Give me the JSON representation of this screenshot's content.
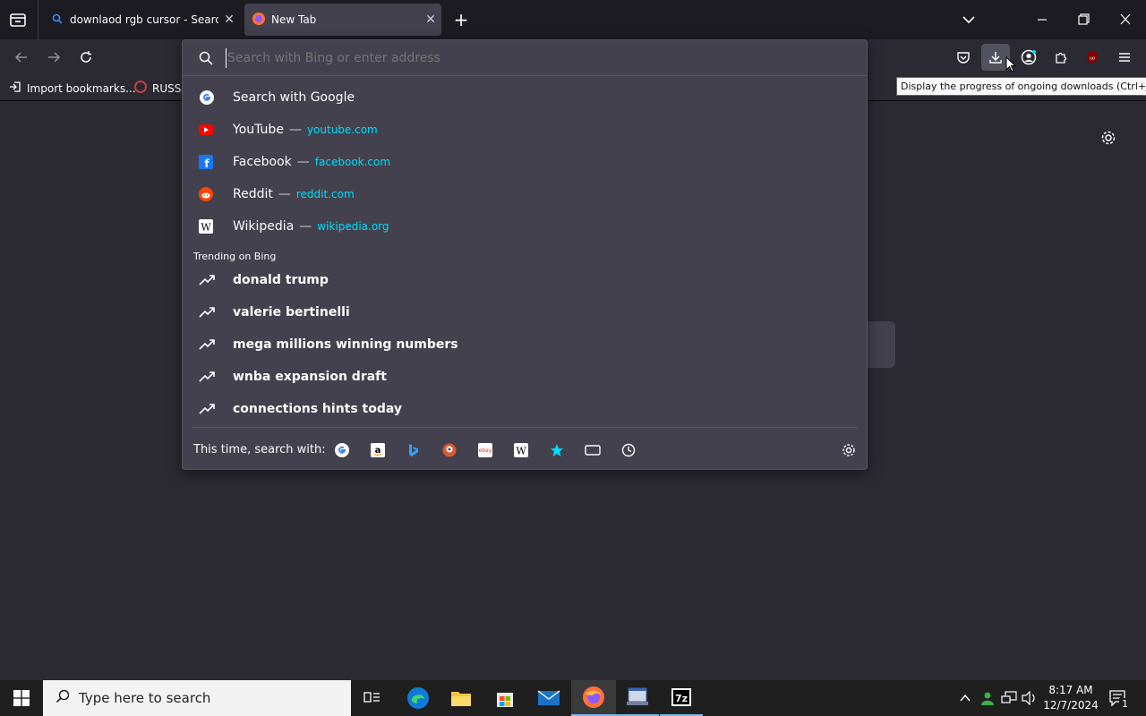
{
  "tabs": [
    {
      "title": "downlaod rgb cursor - Search",
      "active": false
    },
    {
      "title": "New Tab",
      "active": true
    }
  ],
  "address": {
    "placeholder": "Search with Bing or enter address",
    "value": ""
  },
  "bookmarks": [
    {
      "label": "Import bookmarks..."
    },
    {
      "label": "RUSSI"
    }
  ],
  "tooltip": "Display the progress of ongoing downloads (Ctrl+J)",
  "suggestions": {
    "search_google": "Search with Google",
    "sites": [
      {
        "name": "YouTube",
        "sep": "—",
        "url": "youtube.com",
        "icon": "youtube-icon"
      },
      {
        "name": "Facebook",
        "sep": "—",
        "url": "facebook.com",
        "icon": "facebook-icon"
      },
      {
        "name": "Reddit",
        "sep": "—",
        "url": "reddit.com",
        "icon": "reddit-icon"
      },
      {
        "name": "Wikipedia",
        "sep": "—",
        "url": "wikipedia.org",
        "icon": "wikipedia-icon"
      }
    ],
    "trending_header": "Trending on Bing",
    "trending": [
      "donald trump",
      "valerie bertinelli",
      "mega millions winning numbers",
      "wnba expansion draft",
      "connections hints today"
    ],
    "search_with_label": "This time, search with:"
  },
  "taskbar": {
    "search_placeholder": "Type here to search",
    "time": "8:17 AM",
    "date": "12/7/2024",
    "notification_count": "1"
  },
  "colors": {
    "accent": "#00ddff",
    "popup_bg": "#42414d",
    "toolbar_bg": "#2b2a33"
  }
}
